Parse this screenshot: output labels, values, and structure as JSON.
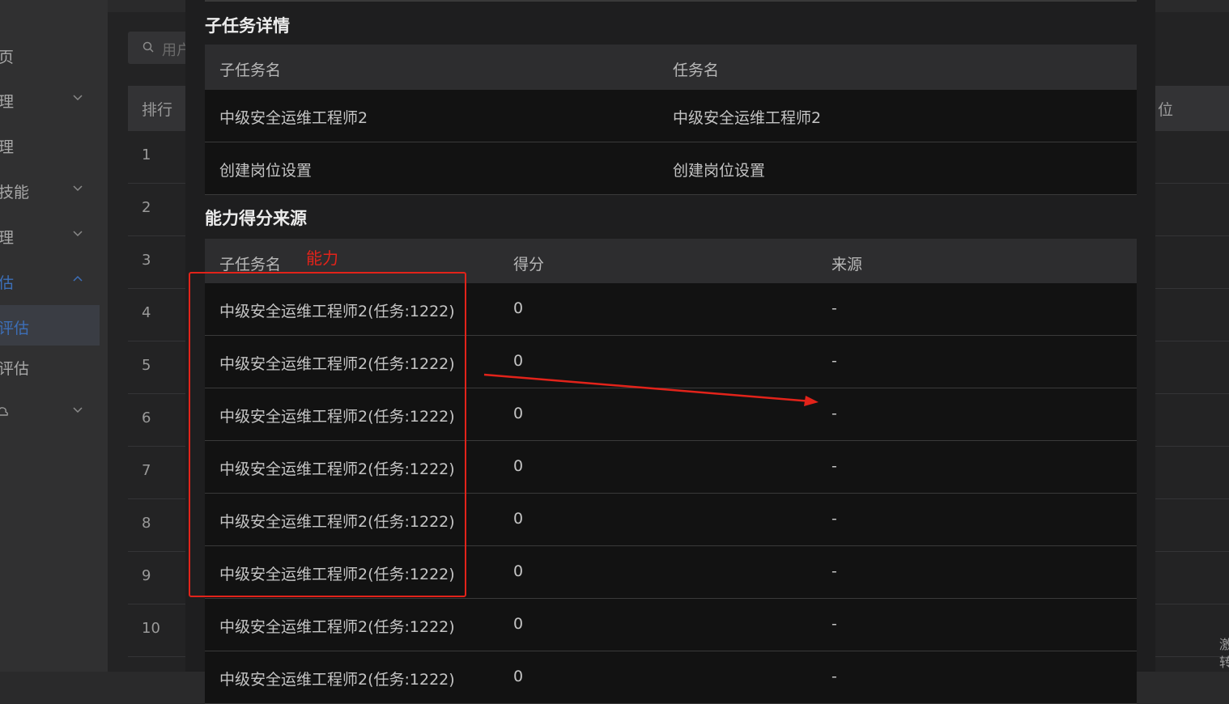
{
  "sidebar": {
    "items": [
      {
        "label": "页",
        "chevron": ""
      },
      {
        "label": "理",
        "chevron": "chevron-down"
      },
      {
        "label": "理",
        "chevron": ""
      },
      {
        "label": "技能",
        "chevron": "chevron-down"
      },
      {
        "label": "理",
        "chevron": "chevron-down"
      },
      {
        "label": "估",
        "chevron": "chevron-up"
      },
      {
        "label": "评估",
        "chevron": ""
      },
      {
        "label": "评估",
        "chevron": ""
      },
      {
        "label": "",
        "chevron": "chevron-down"
      }
    ]
  },
  "background": {
    "search_placeholder": "用户",
    "table_header_rank": "排行",
    "table_header_right": "位",
    "rows": [
      "1",
      "2",
      "3",
      "4",
      "5",
      "6",
      "7",
      "8",
      "9",
      "10"
    ],
    "corner_text_1": "激",
    "corner_text_2": "转"
  },
  "modal": {
    "subtask_section_title": "子任务详情",
    "subtask_table": {
      "headers": [
        "子任务名",
        "任务名"
      ],
      "rows": [
        [
          "中级安全运维工程师2",
          "中级安全运维工程师2"
        ],
        [
          "创建岗位设置",
          "创建岗位设置"
        ]
      ]
    },
    "ability_section_title": "能力得分来源",
    "ability_table": {
      "headers": [
        "子任务名",
        "得分",
        "来源"
      ],
      "rows": [
        [
          "中级安全运维工程师2(任务:1222)",
          "0",
          "-"
        ],
        [
          "中级安全运维工程师2(任务:1222)",
          "0",
          "-"
        ],
        [
          "中级安全运维工程师2(任务:1222)",
          "0",
          "-"
        ],
        [
          "中级安全运维工程师2(任务:1222)",
          "0",
          "-"
        ],
        [
          "中级安全运维工程师2(任务:1222)",
          "0",
          "-"
        ],
        [
          "中级安全运维工程师2(任务:1222)",
          "0",
          "-"
        ],
        [
          "中级安全运维工程师2(任务:1222)",
          "0",
          "-"
        ],
        [
          "中级安全运维工程师2(任务:1222)",
          "0",
          "-"
        ]
      ]
    }
  },
  "annotation": {
    "label": "能力",
    "color": "#e2231a"
  },
  "colors": {
    "accent": "#3d6fb8",
    "annotation_red": "#e2231a"
  }
}
